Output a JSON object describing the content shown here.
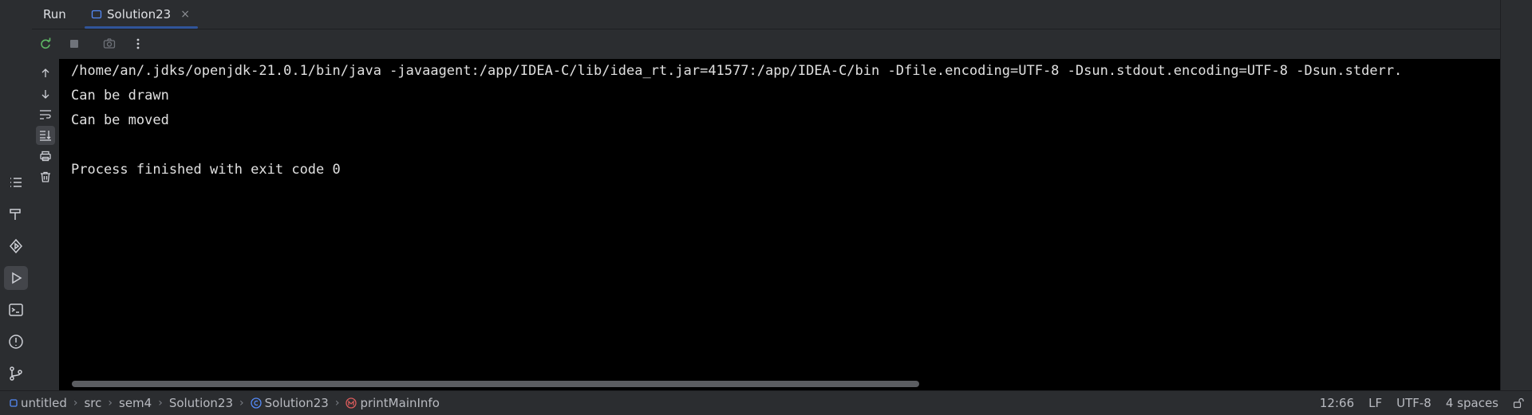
{
  "tool_window": {
    "title": "Run",
    "tab": {
      "label": "Solution23",
      "close": "×"
    }
  },
  "console": {
    "lines": [
      "/home/an/.jdks/openjdk-21.0.1/bin/java -javaagent:/app/IDEA-C/lib/idea_rt.jar=41577:/app/IDEA-C/bin -Dfile.encoding=UTF-8 -Dsun.stdout.encoding=UTF-8 -Dsun.stderr.",
      "Can be drawn",
      "Can be moved",
      "",
      "Process finished with exit code 0"
    ]
  },
  "breadcrumbs": [
    "untitled",
    "src",
    "sem4",
    "Solution23",
    "Solution23",
    "printMainInfo"
  ],
  "status": {
    "position": "12:66",
    "line_separator": "LF",
    "encoding": "UTF-8",
    "indent": "4 spaces"
  },
  "icons": {
    "rerun": "rerun-icon",
    "stop": "stop-icon",
    "camera": "camera-icon",
    "more": "more-icon"
  },
  "colors": {
    "accent": "#3574f0",
    "rerun_green": "#5fb865",
    "method_red": "#db5c5c"
  }
}
